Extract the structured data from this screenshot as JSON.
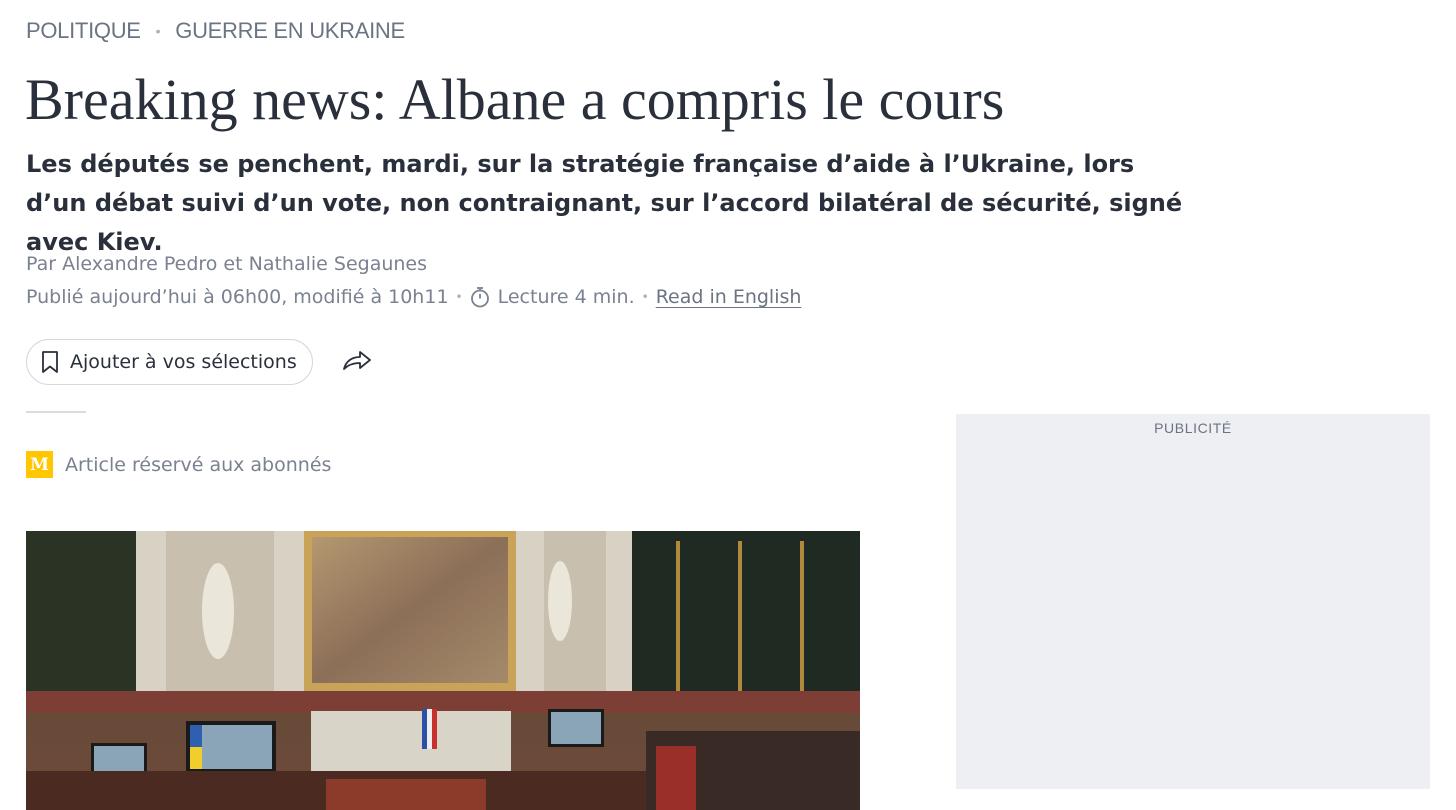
{
  "breadcrumb": {
    "items": [
      "POLITIQUE",
      "GUERRE EN UKRAINE"
    ],
    "separator": "•"
  },
  "article": {
    "title": "Breaking news: Albane a compris le cours",
    "lede": "Les députés se penchent, mardi, sur la stratégie française d’aide à l’Ukraine, lors d’un débat suivi d’un vote, non contraignant, sur l’accord bilatéral de sécurité, signé avec Kiev.",
    "byline": "Par Alexandre Pedro et Nathalie Segaunes",
    "published": "Publié aujourd’hui à 06h00, modifié à 10h11",
    "reading_time": "Lecture 4 min.",
    "read_in_english": "Read in English",
    "meta_separator": "•",
    "subscriber_badge": "Article réservé aux abonnés",
    "subscriber_logo": "M"
  },
  "actions": {
    "save_label": "Ajouter à vos sélections",
    "save_icon": "bookmark-icon",
    "share_icon": "share-arrow-icon"
  },
  "ad": {
    "label": "PUBLICITÉ"
  },
  "colors": {
    "text_dark": "#2a303b",
    "text_muted": "#7a8190",
    "badge_yellow": "#ffc700",
    "ad_background": "#eeeff2"
  }
}
